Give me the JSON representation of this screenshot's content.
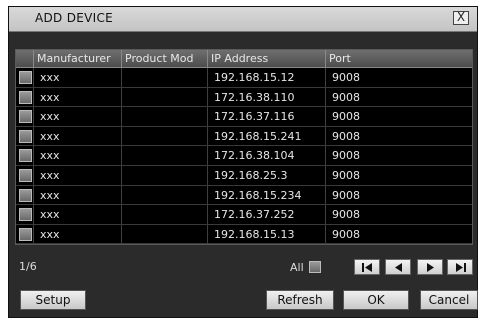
{
  "dialog": {
    "title": "ADD DEVICE",
    "close_label": "X"
  },
  "table": {
    "columns": [
      "Manufacturer",
      "Product Mod",
      "IP Address",
      "Port"
    ],
    "rows": [
      {
        "manufacturer": "xxx",
        "product_model": "",
        "ip": "192.168.15.12",
        "port": "9008"
      },
      {
        "manufacturer": "xxx",
        "product_model": "",
        "ip": "172.16.38.110",
        "port": "9008"
      },
      {
        "manufacturer": "xxx",
        "product_model": "",
        "ip": "172.16.37.116",
        "port": "9008"
      },
      {
        "manufacturer": "xxx",
        "product_model": "",
        "ip": "192.168.15.241",
        "port": "9008"
      },
      {
        "manufacturer": "xxx",
        "product_model": "",
        "ip": "172.16.38.104",
        "port": "9008"
      },
      {
        "manufacturer": "xxx",
        "product_model": "",
        "ip": "192.168.25.3",
        "port": "9008"
      },
      {
        "manufacturer": "xxx",
        "product_model": "",
        "ip": "192.168.15.234",
        "port": "9008"
      },
      {
        "manufacturer": "xxx",
        "product_model": "",
        "ip": "172.16.37.252",
        "port": "9008"
      },
      {
        "manufacturer": "xxx",
        "product_model": "",
        "ip": "192.168.15.13",
        "port": "9008"
      }
    ]
  },
  "footer": {
    "page_indicator": "1/6",
    "all_label": "All"
  },
  "buttons": {
    "setup": "Setup",
    "refresh": "Refresh",
    "ok": "OK",
    "cancel": "Cancel"
  },
  "icons": {
    "first": "first-page-icon",
    "prev": "prev-page-icon",
    "next": "next-page-icon",
    "last": "last-page-icon"
  }
}
